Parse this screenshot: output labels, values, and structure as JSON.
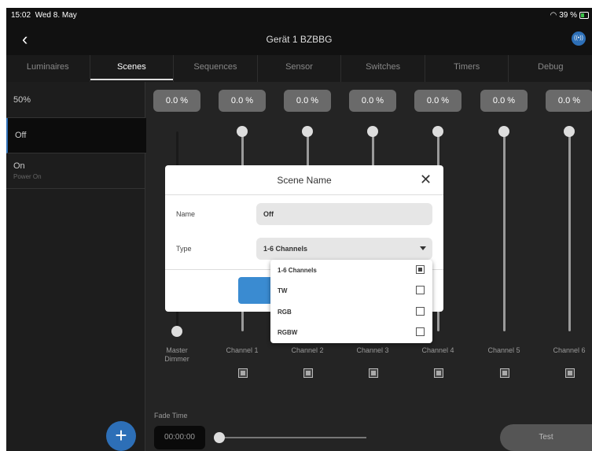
{
  "status_bar": {
    "time": "15:02",
    "date": "Wed 8. May",
    "battery": "39 %"
  },
  "nav": {
    "title": "Gerät 1 BZBBG",
    "back_icon": "chevron-left-icon",
    "device_icon": "radio-icon"
  },
  "tabs": [
    {
      "label": "Luminaires"
    },
    {
      "label": "Scenes",
      "active": true
    },
    {
      "label": "Sequences"
    },
    {
      "label": "Sensor"
    },
    {
      "label": "Switches"
    },
    {
      "label": "Timers"
    },
    {
      "label": "Debug"
    }
  ],
  "sidebar": {
    "scenes": [
      {
        "name": "50%",
        "subtitle": ""
      },
      {
        "name": "Off",
        "subtitle": "",
        "selected": true
      },
      {
        "name": "On",
        "subtitle": "Power On"
      }
    ]
  },
  "channels": [
    {
      "value": "0.0 %",
      "label": "Master Dimmer",
      "level": 0,
      "has_checkbox": false
    },
    {
      "value": "0.0 %",
      "label": "Channel 1",
      "level": 0,
      "has_checkbox": true
    },
    {
      "value": "0.0 %",
      "label": "Channel 2",
      "level": 0,
      "has_checkbox": true
    },
    {
      "value": "0.0 %",
      "label": "Channel 3",
      "level": 0,
      "has_checkbox": true
    },
    {
      "value": "0.0 %",
      "label": "Channel 4",
      "level": 0,
      "has_checkbox": true
    },
    {
      "value": "0.0 %",
      "label": "Channel 5",
      "level": 0,
      "has_checkbox": true
    },
    {
      "value": "0.0 %",
      "label": "Channel 6",
      "level": 0,
      "has_checkbox": true
    }
  ],
  "footer": {
    "fade_label": "Fade Time",
    "fade_value": "00:00:00",
    "test_label": "Test"
  },
  "modal": {
    "title": "Scene Name",
    "name_label": "Name",
    "name_value": "Off",
    "type_label": "Type",
    "type_value": "1-6 Channels",
    "options": [
      {
        "label": "1-6 Channels",
        "checked": true
      },
      {
        "label": "TW",
        "checked": false
      },
      {
        "label": "RGB",
        "checked": false
      },
      {
        "label": "RGBW",
        "checked": false
      }
    ]
  },
  "colors": {
    "accent": "#2d6fb7",
    "background": "#242424",
    "sidebar": "#1d1d1d"
  }
}
